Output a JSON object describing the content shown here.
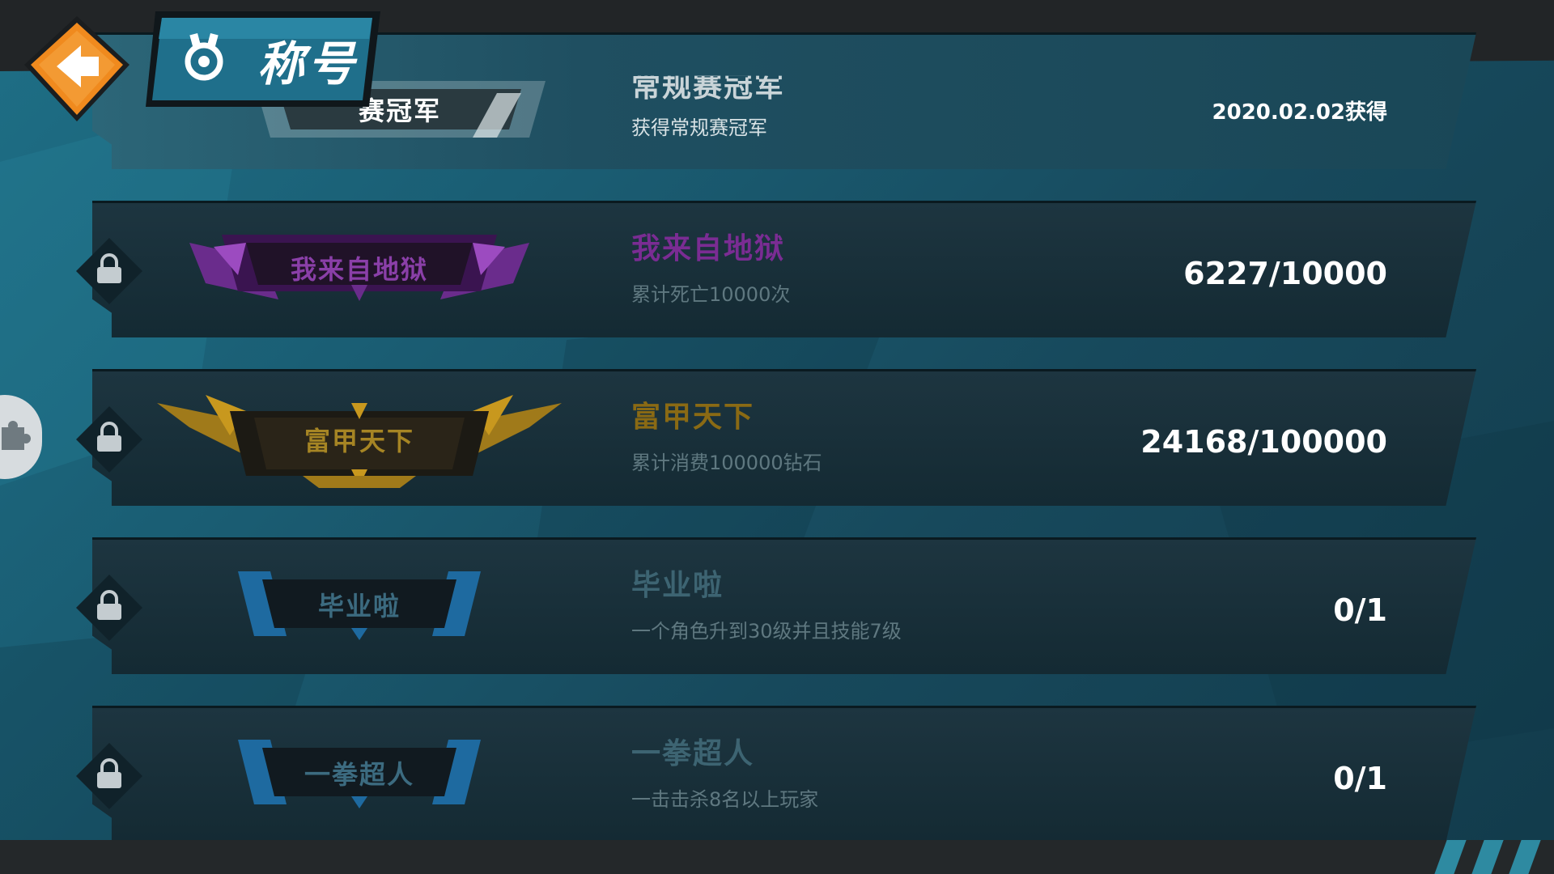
{
  "header": {
    "back_icon": "back-arrow-icon",
    "medal_icon": "medal-icon",
    "title": "称号"
  },
  "titles": [
    {
      "name": "常规赛冠军",
      "badge_label": "赛冠军",
      "badge_text_visible": "赛冠军",
      "description": "获得常规赛冠军",
      "status": "2020.02.02获得",
      "locked": false,
      "title_color": "#c9d4d8"
    },
    {
      "name": "我来自地狱",
      "badge_label": "我来自地狱",
      "description": "累计死亡10000次",
      "status": "6227/10000",
      "locked": true,
      "title_color": "#7a2c93",
      "progress": 0.6227
    },
    {
      "name": "富甲天下",
      "badge_label": "富甲天下",
      "description": "累计消费100000钻石",
      "status": "24168/100000",
      "locked": true,
      "title_color": "#8a6a14",
      "progress": 0.24168
    },
    {
      "name": "毕业啦",
      "badge_label": "毕业啦",
      "description": "一个角色升到30级并且技能7级",
      "status": "0/1",
      "locked": true,
      "title_color": "#3d6472",
      "progress": 0
    },
    {
      "name": "一拳超人",
      "badge_label": "一拳超人",
      "description": "一击击杀8名以上玩家",
      "status": "0/1",
      "locked": true,
      "title_color": "#3d6472",
      "progress": 0
    }
  ],
  "side_button_icon": "puzzle-icon"
}
